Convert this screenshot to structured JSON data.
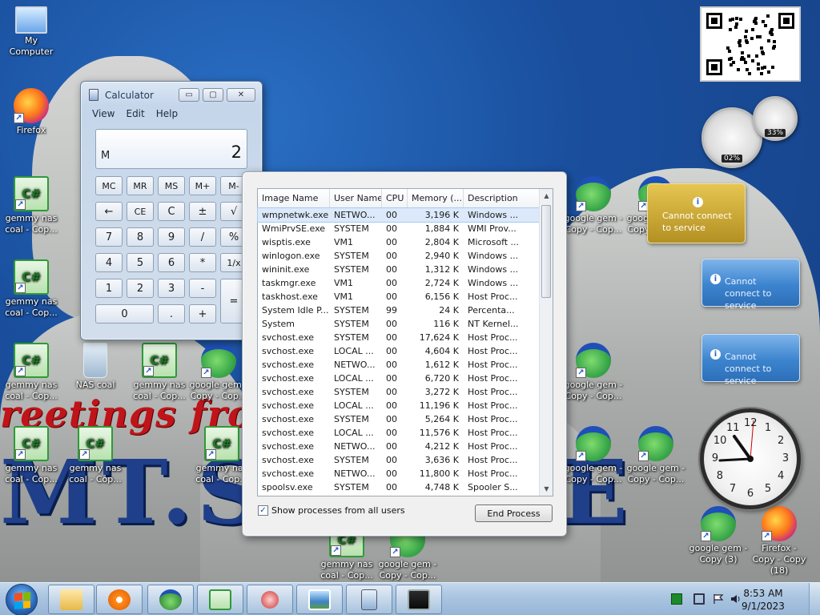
{
  "desktop": {
    "icons": [
      {
        "label": "My Computer",
        "type": "pc"
      },
      {
        "label": "Firefox",
        "type": "ff"
      },
      {
        "label": "gemmy nas coal - Cop...",
        "type": "cs"
      },
      {
        "label": "gemmy nas coal - Cop...",
        "type": "cs"
      },
      {
        "label": "gemmy nas coal - Cop...",
        "type": "cs"
      },
      {
        "label": "NAS coal",
        "type": "bin"
      },
      {
        "label": "gemmy nas coal - Cop...",
        "type": "cs"
      },
      {
        "label": "google gem - Copy - Cop...",
        "type": "frog"
      },
      {
        "label": "gemmy nas coal - Cop...",
        "type": "cs"
      },
      {
        "label": "gemmy nas coal - Cop...",
        "type": "cs"
      },
      {
        "label": "gemmy nas coal - Cop...",
        "type": "cs"
      },
      {
        "label": "gemmy nas coal - Cop...",
        "type": "cs"
      },
      {
        "label": "google gem - Copy - Cop...",
        "type": "frog"
      },
      {
        "label": "google gem - Copy - Cop...",
        "type": "frog"
      },
      {
        "label": "google gem - Copy - Cop...",
        "type": "frog"
      },
      {
        "label": "google gem - Copy - Cop...",
        "type": "frog"
      },
      {
        "label": "google gem - Copy - Cop...",
        "type": "frog"
      },
      {
        "label": "google gem - Copy - Cop...",
        "type": "frog"
      },
      {
        "label": "google gem - Copy (3)",
        "type": "frog"
      },
      {
        "label": "Firefox - Copy - Copy (18)",
        "type": "ff"
      }
    ],
    "wallpaper_text": {
      "greeting": "reetings from",
      "mt": "MT.S",
      "mt2": "E"
    }
  },
  "calculator": {
    "title": "Calculator",
    "menu": [
      "View",
      "Edit",
      "Help"
    ],
    "display": {
      "memory": "M",
      "value": "2"
    },
    "keys": [
      [
        "MC",
        "MR",
        "MS",
        "M+",
        "M-"
      ],
      [
        "←",
        "CE",
        "C",
        "±",
        "√"
      ],
      [
        "7",
        "8",
        "9",
        "/",
        "%"
      ],
      [
        "4",
        "5",
        "6",
        "*",
        "1/x"
      ],
      [
        "1",
        "2",
        "3",
        "-",
        "="
      ],
      [
        "0",
        ".",
        "+"
      ]
    ],
    "window_buttons": {
      "minimize": "▭",
      "maximize": "▢",
      "close": "✕"
    }
  },
  "task_manager": {
    "columns": [
      "Image Name",
      "User Name",
      "CPU",
      "Memory (...",
      "Description"
    ],
    "processes": [
      [
        "wmpnetwk.exe",
        "NETWO...",
        "00",
        "3,196 K",
        "Windows ..."
      ],
      [
        "WmiPrvSE.exe",
        "SYSTEM",
        "00",
        "1,884 K",
        "WMI Prov..."
      ],
      [
        "wisptis.exe",
        "VM1",
        "00",
        "2,804 K",
        "Microsoft ..."
      ],
      [
        "winlogon.exe",
        "SYSTEM",
        "00",
        "2,940 K",
        "Windows ..."
      ],
      [
        "wininit.exe",
        "SYSTEM",
        "00",
        "1,312 K",
        "Windows ..."
      ],
      [
        "taskmgr.exe",
        "VM1",
        "00",
        "2,724 K",
        "Windows ..."
      ],
      [
        "taskhost.exe",
        "VM1",
        "00",
        "6,156 K",
        "Host Proc..."
      ],
      [
        "System Idle P...",
        "SYSTEM",
        "99",
        "24 K",
        "Percenta..."
      ],
      [
        "System",
        "SYSTEM",
        "00",
        "116 K",
        "NT Kernel..."
      ],
      [
        "svchost.exe",
        "SYSTEM",
        "00",
        "17,624 K",
        "Host Proc..."
      ],
      [
        "svchost.exe",
        "LOCAL ...",
        "00",
        "4,604 K",
        "Host Proc..."
      ],
      [
        "svchost.exe",
        "NETWO...",
        "00",
        "1,612 K",
        "Host Proc..."
      ],
      [
        "svchost.exe",
        "LOCAL ...",
        "00",
        "6,720 K",
        "Host Proc..."
      ],
      [
        "svchost.exe",
        "SYSTEM",
        "00",
        "3,272 K",
        "Host Proc..."
      ],
      [
        "svchost.exe",
        "LOCAL ...",
        "00",
        "11,196 K",
        "Host Proc..."
      ],
      [
        "svchost.exe",
        "SYSTEM",
        "00",
        "5,264 K",
        "Host Proc..."
      ],
      [
        "svchost.exe",
        "LOCAL ...",
        "00",
        "11,576 K",
        "Host Proc..."
      ],
      [
        "svchost.exe",
        "NETWO...",
        "00",
        "4,212 K",
        "Host Proc..."
      ],
      [
        "svchost.exe",
        "SYSTEM",
        "00",
        "3,636 K",
        "Host Proc..."
      ],
      [
        "svchost.exe",
        "NETWO...",
        "00",
        "11,800 K",
        "Host Proc..."
      ],
      [
        "spoolsv.exe",
        "SYSTEM",
        "00",
        "4,748 K",
        "Spooler S..."
      ]
    ],
    "show_all_label": "Show processes from all users",
    "show_all_checked": true,
    "end_process_label": "End Process"
  },
  "gadgets": {
    "cpu_gauge": {
      "value": "02%"
    },
    "mem_gauge": {
      "value": "33%"
    },
    "notices": [
      {
        "text": "Cannot connect to service"
      },
      {
        "text": "Cannot connect to service"
      },
      {
        "text": "Cannot connect to service"
      }
    ],
    "clock": {
      "numbers": [
        "12",
        "1",
        "2",
        "3",
        "4",
        "5",
        "6",
        "7",
        "8",
        "9",
        "10",
        "11"
      ]
    }
  },
  "taskbar": {
    "time": "8:53 AM",
    "date": "9/1/2023",
    "pinned": [
      "explorer",
      "media-player",
      "frog",
      "csharp",
      "snipping",
      "photos",
      "calculator",
      "task-manager"
    ]
  },
  "colors": {
    "desktop_blue": "#1a4f9e",
    "taskbar": "#a9c4e0",
    "notice_blue": "#3c84cf",
    "notice_gold": "#b39022"
  }
}
